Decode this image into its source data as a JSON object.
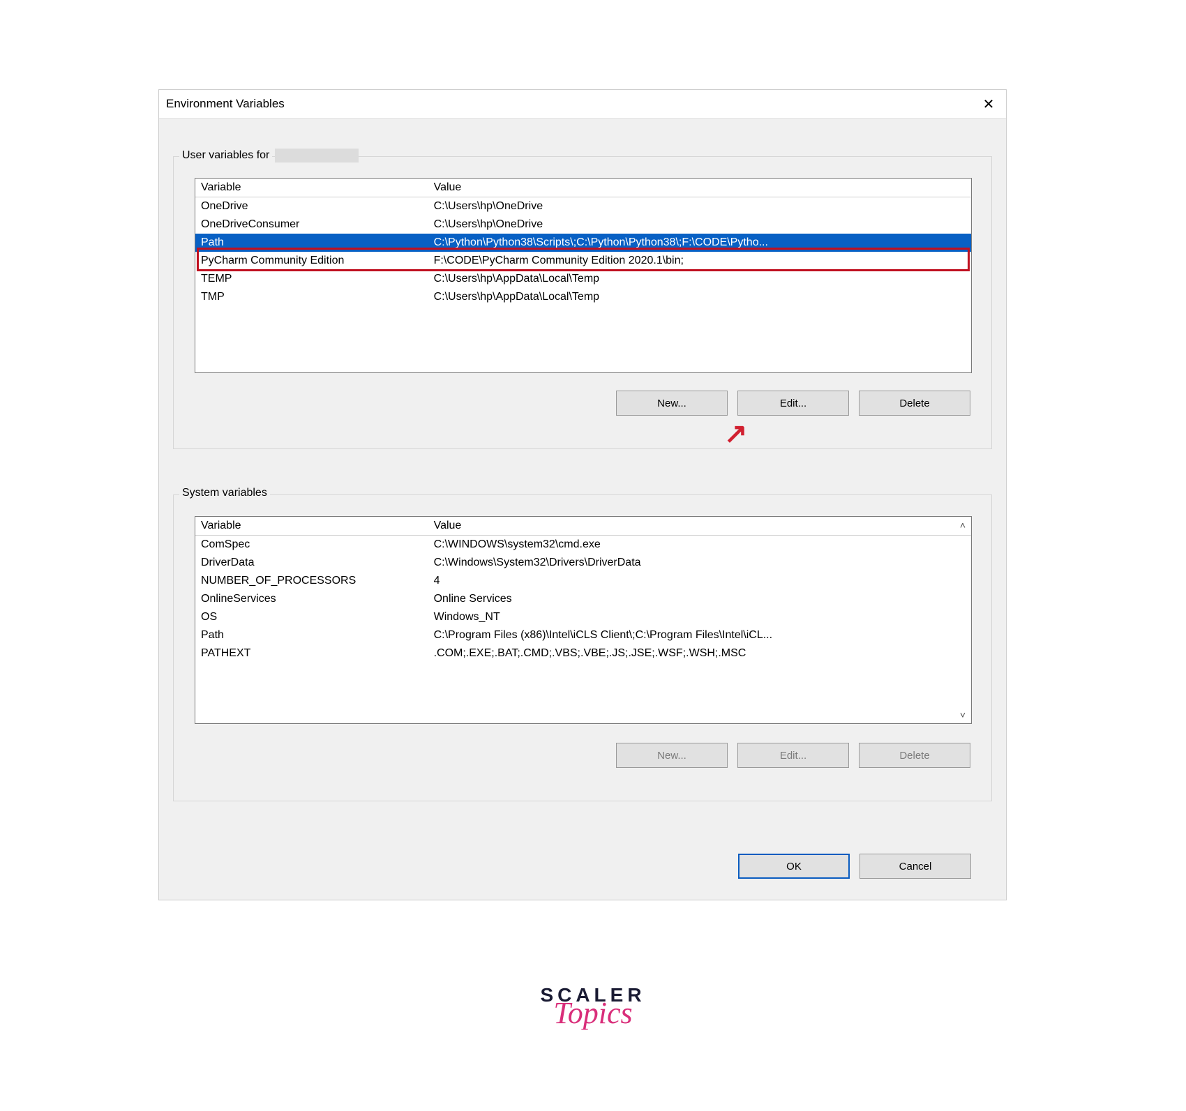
{
  "dialog": {
    "title": "Environment Variables",
    "close_glyph": "✕"
  },
  "user_group": {
    "label_prefix": "User variables for",
    "headers": {
      "variable": "Variable",
      "value": "Value"
    },
    "rows": [
      {
        "variable": "OneDrive",
        "value": "C:\\Users\\hp\\OneDrive",
        "selected": false
      },
      {
        "variable": "OneDriveConsumer",
        "value": "C:\\Users\\hp\\OneDrive",
        "selected": false
      },
      {
        "variable": "Path",
        "value": "C:\\Python\\Python38\\Scripts\\;C:\\Python\\Python38\\;F:\\CODE\\Pytho...",
        "selected": true
      },
      {
        "variable": "PyCharm Community Edition",
        "value": "F:\\CODE\\PyCharm Community Edition 2020.1\\bin;",
        "selected": false
      },
      {
        "variable": "TEMP",
        "value": "C:\\Users\\hp\\AppData\\Local\\Temp",
        "selected": false
      },
      {
        "variable": "TMP",
        "value": "C:\\Users\\hp\\AppData\\Local\\Temp",
        "selected": false
      }
    ],
    "buttons": {
      "new": "New...",
      "edit": "Edit...",
      "delete": "Delete"
    }
  },
  "system_group": {
    "label": "System variables",
    "headers": {
      "variable": "Variable",
      "value": "Value"
    },
    "rows": [
      {
        "variable": "ComSpec",
        "value": "C:\\WINDOWS\\system32\\cmd.exe"
      },
      {
        "variable": "DriverData",
        "value": "C:\\Windows\\System32\\Drivers\\DriverData"
      },
      {
        "variable": "NUMBER_OF_PROCESSORS",
        "value": "4"
      },
      {
        "variable": "OnlineServices",
        "value": "Online Services"
      },
      {
        "variable": "OS",
        "value": "Windows_NT"
      },
      {
        "variable": "Path",
        "value": "C:\\Program Files (x86)\\Intel\\iCLS Client\\;C:\\Program Files\\Intel\\iCL..."
      },
      {
        "variable": "PATHEXT",
        "value": ".COM;.EXE;.BAT;.CMD;.VBS;.VBE;.JS;.JSE;.WSF;.WSH;.MSC"
      }
    ],
    "buttons": {
      "new": "New...",
      "edit": "Edit...",
      "delete": "Delete"
    }
  },
  "dialog_buttons": {
    "ok": "OK",
    "cancel": "Cancel"
  },
  "logo": {
    "line1": "SCALER",
    "line2": "Topics"
  },
  "arrow_glyph": "↗"
}
